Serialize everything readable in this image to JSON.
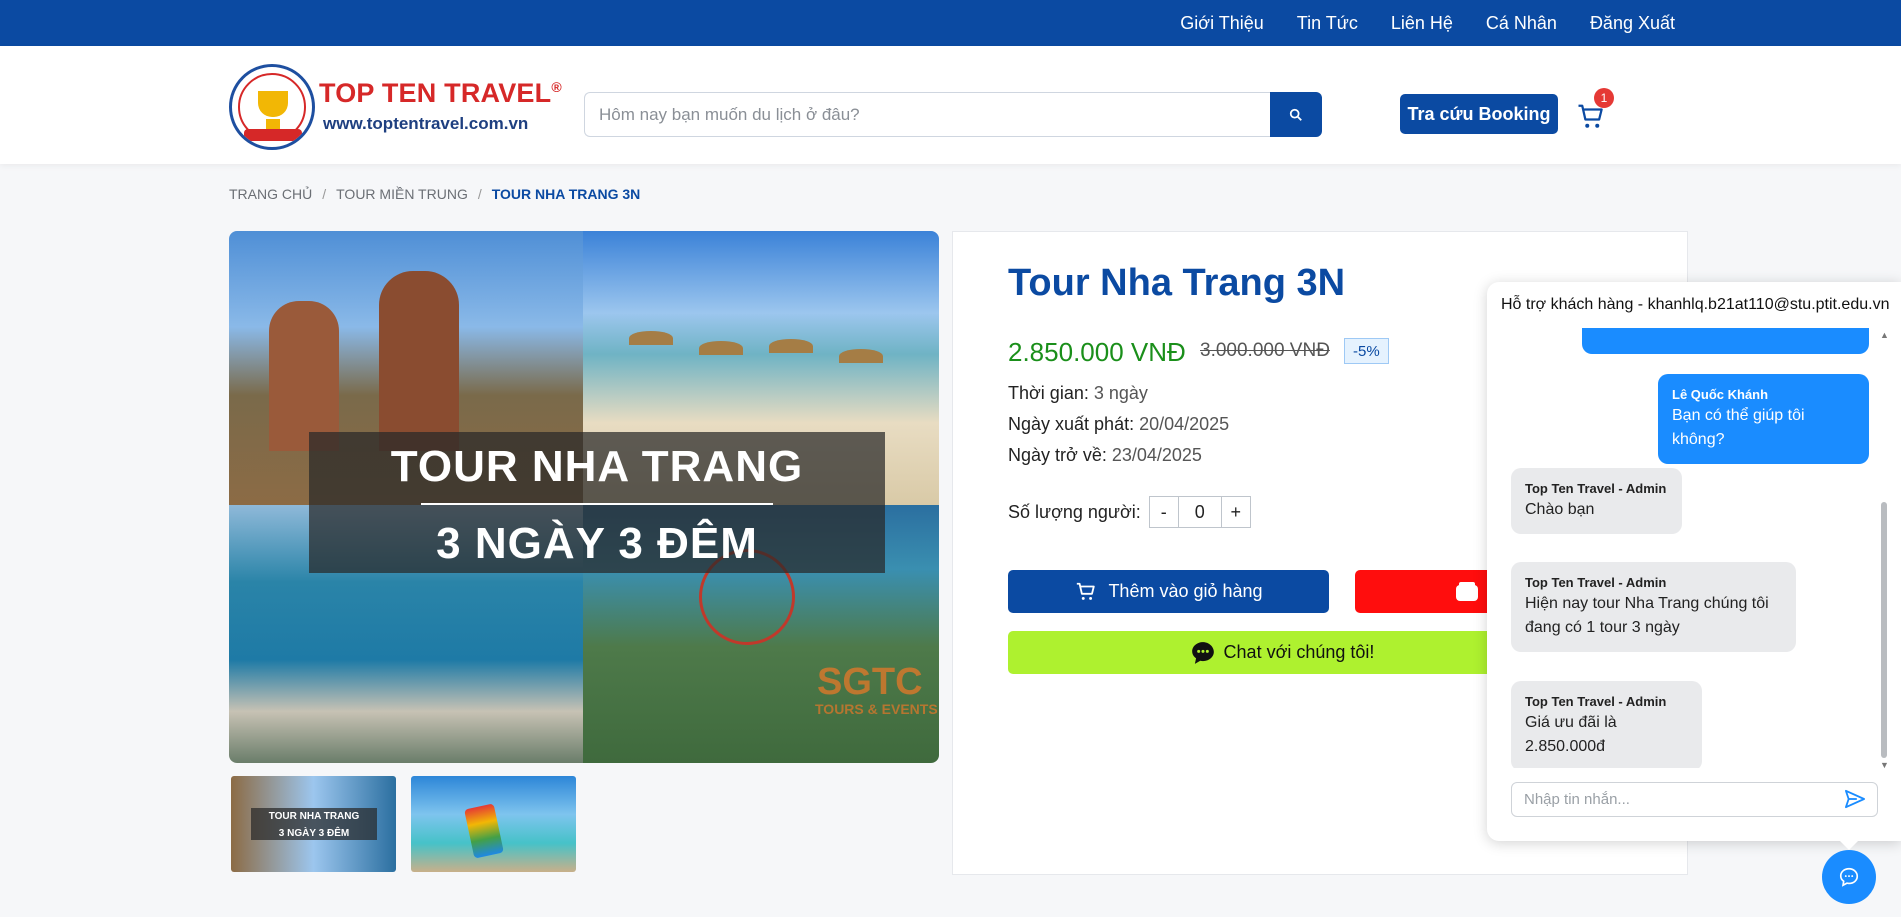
{
  "topnav": {
    "items": [
      "Giới Thiệu",
      "Tin Tức",
      "Liên Hệ",
      "Cá Nhân",
      "Đăng Xuất"
    ]
  },
  "header": {
    "logo_title": "TOP TEN TRAVEL",
    "logo_reg": "®",
    "logo_url": "www.toptentravel.com.vn",
    "search_placeholder": "Hôm nay bạn muốn du lịch ở đâu?",
    "search_icon": "search-icon",
    "lookup_label": "Tra cứu Booking",
    "cart_icon": "cart-icon",
    "cart_count": "1"
  },
  "breadcrumb": {
    "items": [
      "Trang chủ",
      "Tour Miền Trung"
    ],
    "separator": "/",
    "current": "Tour Nha Trang 3N"
  },
  "gallery": {
    "banner_line1": "TOUR NHA TRANG",
    "banner_line2": "3 NGÀY 3 ĐÊM",
    "watermark": "SGTC",
    "watermark_sub": "TOURS & EVENTS",
    "thumb1_line1": "TOUR NHA TRANG",
    "thumb1_line2": "3 NGÀY 3 ĐÊM"
  },
  "tour": {
    "title": "Tour Nha Trang 3N",
    "price": "2.850.000 VNĐ",
    "old_price": "3.000.000 VNĐ",
    "discount": "-5%",
    "duration_label": "Thời gian:",
    "duration_value": "3 ngày",
    "start_label": "Ngày xuất phát:",
    "start_value": "20/04/2025",
    "end_label": "Ngày trở về:",
    "end_value": "23/04/2025",
    "qty_label": "Số lượng người:",
    "qty_minus": "-",
    "qty_value": "0",
    "qty_plus": "+",
    "add_cart_label": "Thêm vào giỏ hàng",
    "chat_label": "Chat với chúng tôi!"
  },
  "chat": {
    "header": "Hỗ trợ khách hàng - khanhlq.b21at110@stu.ptit.edu.vn",
    "messages": [
      {
        "sender": "Lê Quốc Khánh",
        "text": "Bạn có thể giúp tôi không?"
      },
      {
        "sender": "Top Ten Travel - Admin",
        "text": "Chào bạn"
      },
      {
        "sender": "Top Ten Travel - Admin",
        "text": "Hiện nay tour Nha Trang chúng tôi đang có 1 tour 3 ngày"
      },
      {
        "sender": "Top Ten Travel - Admin",
        "text": "Giá ưu đãi là 2.850.000đ"
      }
    ],
    "input_placeholder": "Nhập tin nhắn...",
    "send_icon": "send-icon",
    "fab_icon": "chat-bubble-icon"
  },
  "colors": {
    "brand_blue": "#0b4aa2",
    "price_green": "#1a8f1a",
    "buy_red": "#ff0d0d",
    "chat_green": "#aef12f",
    "chat_blue": "#1a8cff"
  }
}
